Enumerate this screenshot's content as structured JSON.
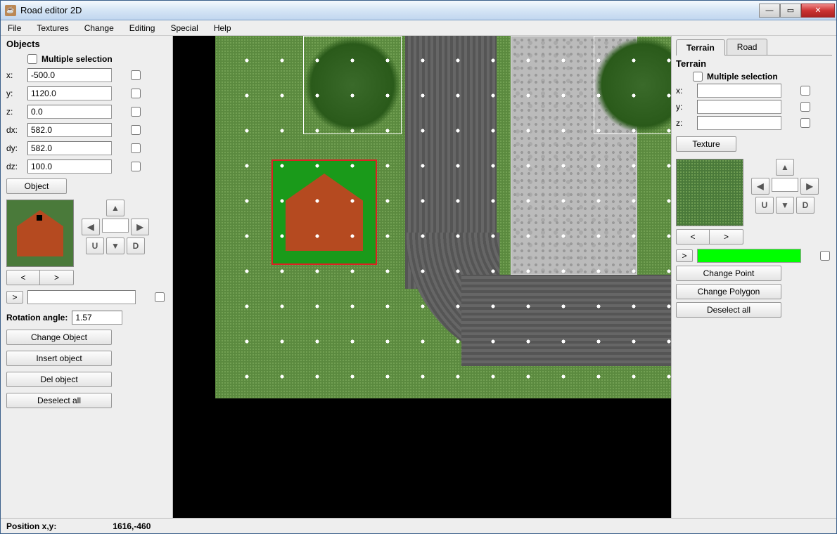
{
  "window": {
    "title": "Road editor 2D"
  },
  "menus": [
    "File",
    "Textures",
    "Change",
    "Editing",
    "Special",
    "Help"
  ],
  "objects_panel": {
    "title": "Objects",
    "multiple_selection_label": "Multiple selection",
    "fields": {
      "x_label": "x:",
      "x_value": "-500.0",
      "y_label": "y:",
      "y_value": "1120.0",
      "z_label": "z:",
      "z_value": "0.0",
      "dx_label": "dx:",
      "dx_value": "582.0",
      "dy_label": "dy:",
      "dy_value": "582.0",
      "dz_label": "dz:",
      "dz_value": "100.0"
    },
    "object_button": "Object",
    "nav": {
      "prev": "<",
      "next": ">",
      "up": "▲",
      "down": "▼",
      "left": "◀",
      "right": "▶",
      "u": "U",
      "d": "D"
    },
    "arrow_prefix": ">",
    "rotation_label": "Rotation angle:",
    "rotation_value": "1.57",
    "change_object": "Change Object",
    "insert_object": "Insert object",
    "del_object": "Del object",
    "deselect_all": "Deselect all"
  },
  "terrain_panel": {
    "tabs": [
      "Terrain",
      "Road"
    ],
    "active_tab": 0,
    "section_title": "Terrain",
    "multiple_selection_label": "Multiple selection",
    "fields": {
      "x_label": "x:",
      "x_value": "",
      "y_label": "y:",
      "y_value": "",
      "z_label": "z:",
      "z_value": ""
    },
    "texture_button": "Texture",
    "nav": {
      "prev": "<",
      "next": ">",
      "up": "▲",
      "down": "▼",
      "left": "◀",
      "right": "▶",
      "u": "U",
      "d": "D"
    },
    "arrow_prefix": ">",
    "change_point": "Change Point",
    "change_polygon": "Change Polygon",
    "deselect_all": "Deselect all"
  },
  "colors": {
    "swatch": "#00ff00"
  },
  "status": {
    "label": "Position x,y:",
    "value": "1616,-460"
  }
}
